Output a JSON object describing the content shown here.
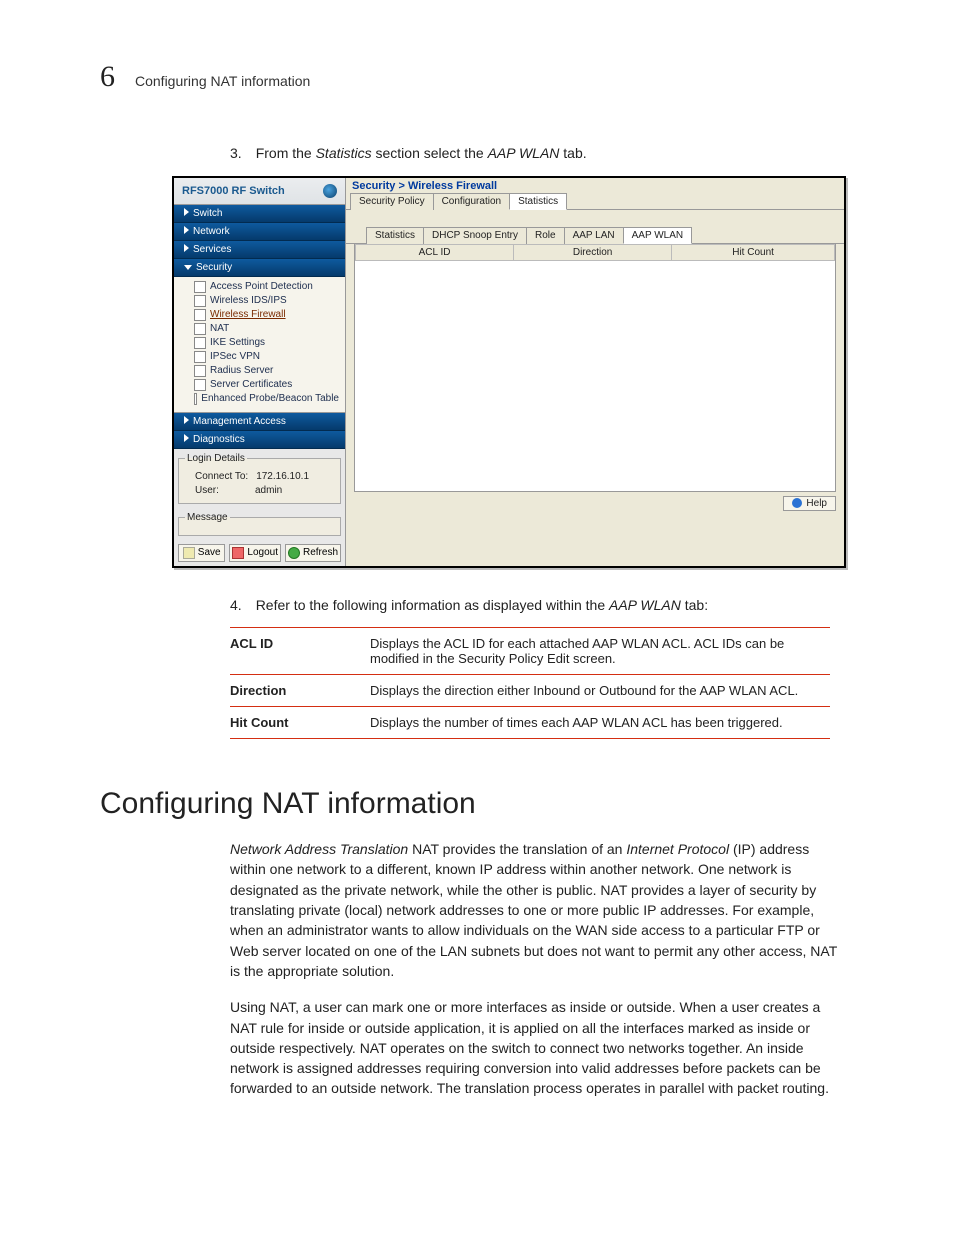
{
  "header": {
    "chapter_number": "6",
    "chapter_title": "Configuring NAT information"
  },
  "step3": {
    "num": "3.",
    "pre": "From the ",
    "italic1": "Statistics",
    "mid": " section select the ",
    "italic2": "AAP WLAN",
    "post": " tab."
  },
  "screenshot": {
    "brand": "RFS7000 RF Switch",
    "nav": {
      "switch": "Switch",
      "network": "Network",
      "services": "Services",
      "security": "Security",
      "management": "Management Access",
      "diagnostics": "Diagnostics"
    },
    "tree": {
      "apd": "Access Point Detection",
      "wids": "Wireless IDS/IPS",
      "wfw": "Wireless Firewall",
      "nat": "NAT",
      "ike": "IKE Settings",
      "ipsec": "IPSec VPN",
      "radius": "Radius Server",
      "certs": "Server Certificates",
      "probe": "Enhanced Probe/Beacon Table"
    },
    "login": {
      "legend": "Login Details",
      "connect_label": "Connect To:",
      "connect_value": "172.16.10.1",
      "user_label": "User:",
      "user_value": "admin"
    },
    "message_legend": "Message",
    "buttons": {
      "save": "Save",
      "logout": "Logout",
      "refresh": "Refresh"
    },
    "crumb": "Security > Wireless Firewall",
    "maintabs": {
      "policy": "Security Policy",
      "config": "Configuration",
      "stats": "Statistics"
    },
    "subtabs": {
      "stats": "Statistics",
      "dhcp": "DHCP Snoop Entry",
      "role": "Role",
      "aaplan": "AAP LAN",
      "aapwlan": "AAP WLAN"
    },
    "cols": {
      "acl": "ACL ID",
      "dir": "Direction",
      "hit": "Hit Count"
    },
    "help": "Help"
  },
  "step4": {
    "num": "4.",
    "pre": "Refer to the following information as displayed within the ",
    "italic": "AAP WLAN",
    "post": " tab:"
  },
  "defs": {
    "acl": {
      "term": "ACL ID",
      "desc": "Displays the ACL ID for each attached AAP WLAN ACL. ACL IDs can be modified in the Security Policy Edit screen."
    },
    "dir": {
      "term": "Direction",
      "desc": "Displays the direction either Inbound or Outbound for the AAP WLAN ACL."
    },
    "hit": {
      "term": "Hit Count",
      "desc": "Displays the number of times each AAP WLAN ACL has been triggered."
    }
  },
  "section_title": "Configuring NAT information",
  "para1": {
    "i1": "Network Address Translation",
    "t1": " NAT provides the translation of an ",
    "i2": "Internet Protocol",
    "t2": " (IP) address within one network to a different, known IP address within another network. One network is designated as the private network, while the other is public. NAT provides a layer of security by translating private (local) network addresses to one or more public IP addresses. For example, when an administrator wants to allow individuals on the WAN side access to a particular FTP or Web server located on one of the LAN subnets but does not want to permit any other access, NAT is the appropriate solution."
  },
  "para2": "Using NAT, a user can mark one or more interfaces as inside or outside. When a user creates a NAT rule for inside or outside application, it is applied on all the interfaces marked as inside or outside respectively. NAT operates on the switch to connect two networks together. An inside network is assigned addresses requiring conversion into valid addresses before packets can be forwarded to an outside network. The translation process operates in parallel with packet routing."
}
